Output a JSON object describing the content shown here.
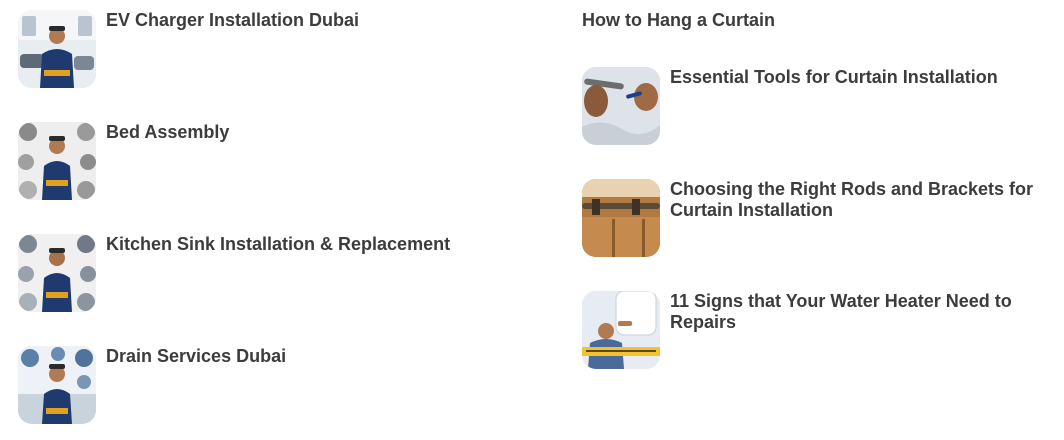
{
  "left_posts": [
    {
      "title": "EV Charger Installation Dubai",
      "thumb_icon": "ev-charger-technician-image"
    },
    {
      "title": "Bed Assembly",
      "thumb_icon": "bed-assembly-technician-image"
    },
    {
      "title": "Kitchen Sink Installation & Replacement",
      "thumb_icon": "kitchen-sink-technician-image"
    },
    {
      "title": "Drain Services Dubai",
      "thumb_icon": "drain-services-technician-image"
    }
  ],
  "right_heading": "How to Hang a Curtain",
  "right_posts": [
    {
      "title": "Essential Tools for Curtain Installation",
      "thumb_icon": "curtain-tools-image"
    },
    {
      "title": "Choosing the Right Rods and Brackets for Curtain Installation",
      "thumb_icon": "curtain-rod-bracket-image"
    },
    {
      "title": "11 Signs that Your Water Heater Need to Repairs",
      "thumb_icon": "water-heater-repair-image"
    }
  ],
  "colors": {
    "title_text": "#3c3c3c",
    "shirt_navy": "#1f3a6e",
    "tool_belt": "#e0a020"
  }
}
